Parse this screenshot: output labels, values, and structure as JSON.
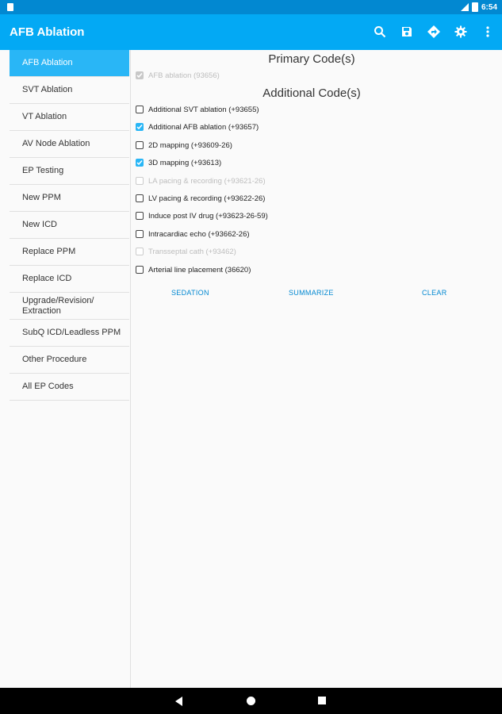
{
  "status_bar": {
    "time": "6:54"
  },
  "app_bar": {
    "title": "AFB Ablation"
  },
  "sidebar": {
    "items": [
      {
        "label": "AFB Ablation",
        "active": true
      },
      {
        "label": "SVT Ablation"
      },
      {
        "label": "VT Ablation"
      },
      {
        "label": "AV Node Ablation"
      },
      {
        "label": "EP Testing"
      },
      {
        "label": "New PPM"
      },
      {
        "label": "New ICD"
      },
      {
        "label": "Replace PPM"
      },
      {
        "label": "Replace ICD"
      },
      {
        "label": "Upgrade/Revision/ Extraction"
      },
      {
        "label": "SubQ ICD/Leadless PPM"
      },
      {
        "label": "Other Procedure"
      },
      {
        "label": "All EP Codes"
      }
    ]
  },
  "main": {
    "primary_heading": "Primary Code(s)",
    "primary_codes": [
      {
        "label": "AFB ablation (93656)",
        "checked": true,
        "disabled": true
      }
    ],
    "additional_heading": "Additional Code(s)",
    "additional_codes": [
      {
        "label": "Additional SVT ablation (+93655)",
        "checked": false,
        "disabled": false
      },
      {
        "label": "Additional AFB ablation (+93657)",
        "checked": true,
        "disabled": false
      },
      {
        "label": "2D mapping (+93609-26)",
        "checked": false,
        "disabled": false
      },
      {
        "label": "3D mapping (+93613)",
        "checked": true,
        "disabled": false
      },
      {
        "label": "LA pacing & recording (+93621-26)",
        "checked": false,
        "disabled": true
      },
      {
        "label": "LV pacing & recording (+93622-26)",
        "checked": false,
        "disabled": false
      },
      {
        "label": "Induce post IV drug (+93623-26-59)",
        "checked": false,
        "disabled": false
      },
      {
        "label": "Intracardiac echo (+93662-26)",
        "checked": false,
        "disabled": false
      },
      {
        "label": "Transseptal cath (+93462)",
        "checked": false,
        "disabled": true
      },
      {
        "label": "Arterial line placement (36620)",
        "checked": false,
        "disabled": false
      }
    ],
    "buttons": {
      "sedation": "SEDATION",
      "summarize": "SUMMARIZE",
      "clear": "CLEAR"
    }
  },
  "colors": {
    "accent": "#29b6f6",
    "app_bar": "#03a9f4",
    "status_bar": "#0288d1"
  }
}
